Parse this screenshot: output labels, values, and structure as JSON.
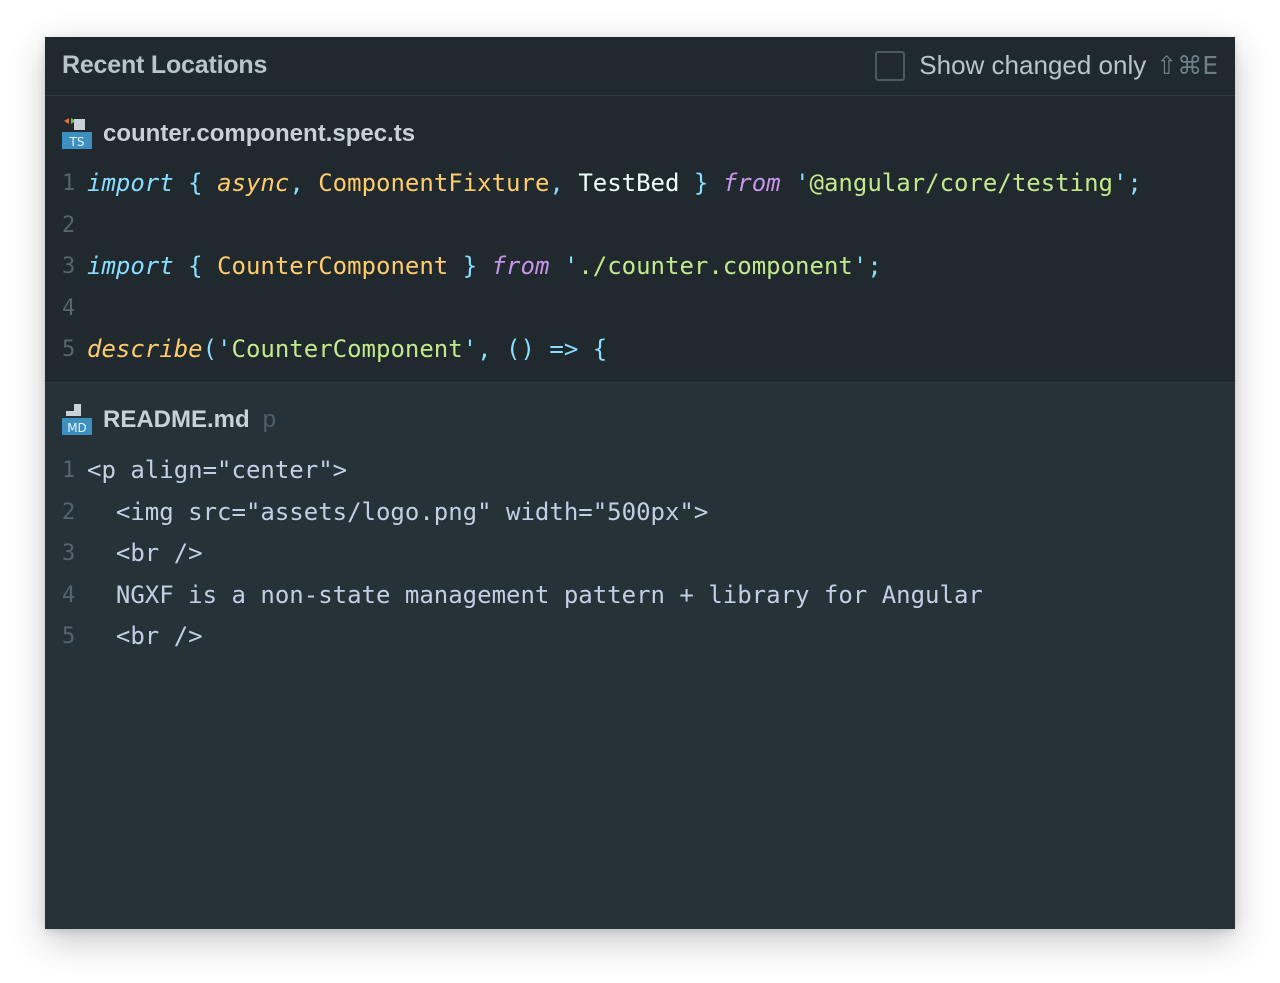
{
  "header": {
    "title": "Recent Locations",
    "show_changed_label": "Show changed only",
    "show_changed_checked": false,
    "shortcut": "⇧⌘E"
  },
  "sections": [
    {
      "file_name": "counter.component.spec.ts",
      "file_icon": "typescript-test-file-icon",
      "file_icon_text": "TS",
      "hint": "",
      "lines": [
        {
          "number": "1",
          "tokens": [
            {
              "t": "import",
              "c": "kw"
            },
            {
              "t": " ",
              "c": "plain"
            },
            {
              "t": "{",
              "c": "pun"
            },
            {
              "t": " ",
              "c": "plain"
            },
            {
              "t": "async",
              "c": "fn"
            },
            {
              "t": ",",
              "c": "pun"
            },
            {
              "t": " ",
              "c": "plain"
            },
            {
              "t": "ComponentFixture",
              "c": "cls"
            },
            {
              "t": ",",
              "c": "pun"
            },
            {
              "t": " ",
              "c": "plain"
            },
            {
              "t": "TestBed",
              "c": "plain"
            },
            {
              "t": " ",
              "c": "plain"
            },
            {
              "t": "}",
              "c": "pun"
            },
            {
              "t": " ",
              "c": "plain"
            },
            {
              "t": "from",
              "c": "kw2"
            },
            {
              "t": " ",
              "c": "plain"
            },
            {
              "t": "'",
              "c": "pun"
            },
            {
              "t": "@angular/core/testing",
              "c": "str"
            },
            {
              "t": "'",
              "c": "pun"
            },
            {
              "t": ";",
              "c": "pun"
            }
          ]
        },
        {
          "number": "2",
          "tokens": []
        },
        {
          "number": "3",
          "tokens": [
            {
              "t": "import",
              "c": "kw"
            },
            {
              "t": " ",
              "c": "plain"
            },
            {
              "t": "{",
              "c": "pun"
            },
            {
              "t": " ",
              "c": "plain"
            },
            {
              "t": "CounterComponent",
              "c": "cls"
            },
            {
              "t": " ",
              "c": "plain"
            },
            {
              "t": "}",
              "c": "pun"
            },
            {
              "t": " ",
              "c": "plain"
            },
            {
              "t": "from",
              "c": "kw2"
            },
            {
              "t": " ",
              "c": "plain"
            },
            {
              "t": "'",
              "c": "pun"
            },
            {
              "t": "./counter.component",
              "c": "str"
            },
            {
              "t": "'",
              "c": "pun"
            },
            {
              "t": ";",
              "c": "pun"
            }
          ]
        },
        {
          "number": "4",
          "tokens": []
        },
        {
          "number": "5",
          "tokens": [
            {
              "t": "describe",
              "c": "fn"
            },
            {
              "t": "(",
              "c": "pun"
            },
            {
              "t": "'",
              "c": "pun"
            },
            {
              "t": "CounterComponent",
              "c": "str"
            },
            {
              "t": "'",
              "c": "pun"
            },
            {
              "t": ",",
              "c": "pun"
            },
            {
              "t": " ",
              "c": "plain"
            },
            {
              "t": "()",
              "c": "pun"
            },
            {
              "t": " ",
              "c": "plain"
            },
            {
              "t": "=>",
              "c": "kw"
            },
            {
              "t": " ",
              "c": "plain"
            },
            {
              "t": "{",
              "c": "pun"
            }
          ]
        }
      ]
    },
    {
      "file_name": "README.md",
      "file_icon": "markdown-file-icon",
      "file_icon_text": "MD",
      "hint": "p",
      "lines": [
        {
          "number": "1",
          "tokens": [
            {
              "t": "<p align=\"center\">",
              "c": "md"
            }
          ]
        },
        {
          "number": "2",
          "tokens": [
            {
              "t": "  <img src=\"assets/logo.png\" width=\"500px\">",
              "c": "md"
            }
          ]
        },
        {
          "number": "3",
          "tokens": [
            {
              "t": "  <br />",
              "c": "md"
            }
          ]
        },
        {
          "number": "4",
          "tokens": [
            {
              "t": "  NGXF is a non-state management pattern + library for Angular",
              "c": "md"
            }
          ]
        },
        {
          "number": "5",
          "tokens": [
            {
              "t": "  <br />",
              "c": "md"
            }
          ]
        }
      ]
    }
  ]
}
